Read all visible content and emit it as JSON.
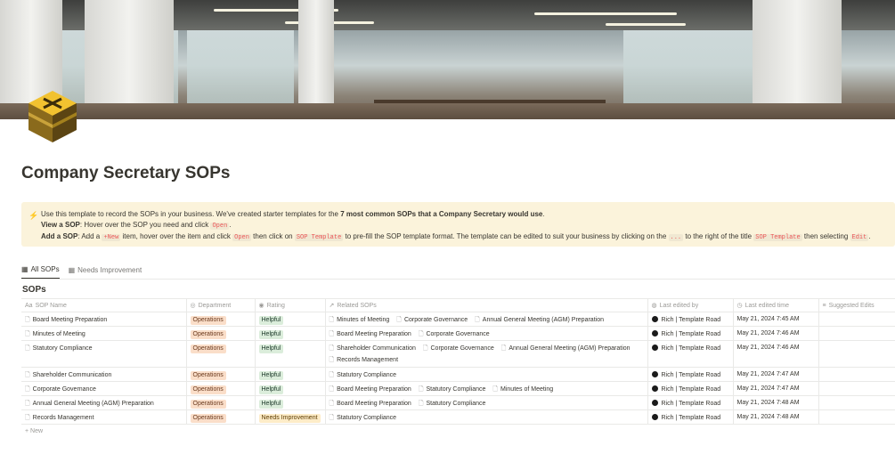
{
  "page": {
    "title": "Company Secretary SOPs"
  },
  "callout": {
    "line1_pre": "Use this template to record the SOPs in your business. We've created starter templates for the ",
    "line1_bold": "7 most common SOPs that a Company Secretary would use",
    "line1_post": ".",
    "line2_bold": "View a SOP",
    "line2_text": ": Hover over the SOP you need and click ",
    "line2_code": "Open",
    "line2_post": ".",
    "line3_bold": "Add a SOP",
    "line3_t1": ": Add a ",
    "line3_code1": "+New",
    "line3_t2": " item, hover over the item and click ",
    "line3_code2": "Open",
    "line3_t3": " then click on ",
    "line3_code3": "SOP Template",
    "line3_t4": " to pre-fill the SOP template format. The template can be edited to suit your business by clicking on the ",
    "line3_code4": "...",
    "line3_t5": " to the right of the title ",
    "line3_code5": "SOP Template",
    "line3_t6": " then selecting ",
    "line3_code6": "Edit",
    "line3_t7": "."
  },
  "tabs": [
    {
      "label": "All SOPs"
    },
    {
      "label": "Needs Improvement"
    }
  ],
  "database": {
    "title": "SOPs",
    "columns": [
      "SOP Name",
      "Department",
      "Rating",
      "Related SOPs",
      "Last edited by",
      "Last edited time",
      "Suggested Edits"
    ],
    "rows": [
      {
        "name": "Board Meeting Preparation",
        "department": "Operations",
        "rating": "Helpful",
        "related": [
          "Minutes of Meeting",
          "Corporate Governance",
          "Annual General Meeting (AGM) Preparation"
        ],
        "editor": "Rich | Template Road",
        "time": "May 21, 2024 7:45 AM"
      },
      {
        "name": "Minutes of Meeting",
        "department": "Operations",
        "rating": "Helpful",
        "related": [
          "Board Meeting Preparation",
          "Corporate Governance"
        ],
        "editor": "Rich | Template Road",
        "time": "May 21, 2024 7:46 AM"
      },
      {
        "name": "Statutory Compliance",
        "department": "Operations",
        "rating": "Helpful",
        "related": [
          "Shareholder Communication",
          "Corporate Governance",
          "Annual General Meeting (AGM) Preparation",
          "Records Management"
        ],
        "editor": "Rich | Template Road",
        "time": "May 21, 2024 7:46 AM"
      },
      {
        "name": "Shareholder Communication",
        "department": "Operations",
        "rating": "Helpful",
        "related": [
          "Statutory Compliance"
        ],
        "editor": "Rich | Template Road",
        "time": "May 21, 2024 7:47 AM"
      },
      {
        "name": "Corporate Governance",
        "department": "Operations",
        "rating": "Helpful",
        "related": [
          "Board Meeting Preparation",
          "Statutory Compliance",
          "Minutes of Meeting"
        ],
        "editor": "Rich | Template Road",
        "time": "May 21, 2024 7:47 AM"
      },
      {
        "name": "Annual General Meeting (AGM) Preparation",
        "department": "Operations",
        "rating": "Helpful",
        "related": [
          "Board Meeting Preparation",
          "Statutory Compliance"
        ],
        "editor": "Rich | Template Road",
        "time": "May 21, 2024 7:48 AM"
      },
      {
        "name": "Records Management",
        "department": "Operations",
        "rating": "Needs Improvement",
        "related": [
          "Statutory Compliance"
        ],
        "editor": "Rich | Template Road",
        "time": "May 21, 2024 7:48 AM"
      }
    ],
    "new_label": "+ New"
  },
  "colors": {
    "callout_bg": "#fbf3db",
    "tag_operations": "#fadec9",
    "tag_helpful": "#dbeddb",
    "tag_needs_improvement": "#fdecc8"
  }
}
